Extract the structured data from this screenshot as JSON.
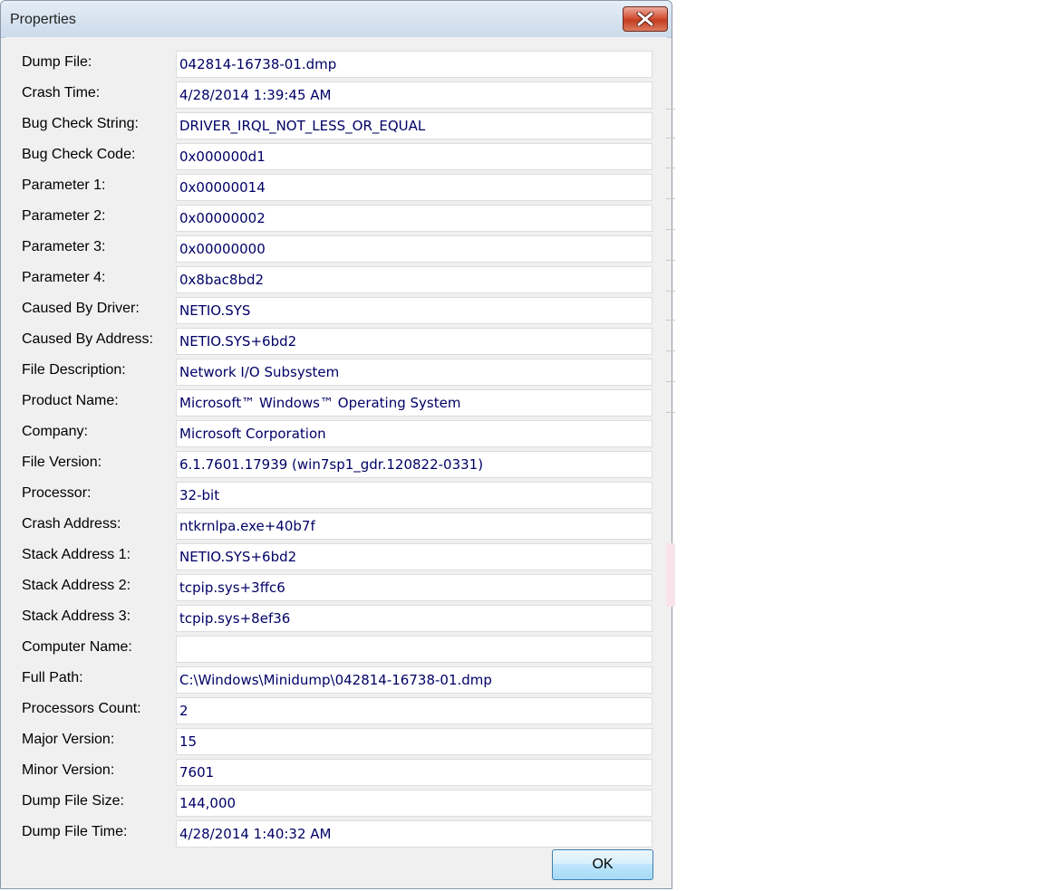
{
  "window": {
    "title": "Properties"
  },
  "properties": [
    {
      "label": "Dump File:",
      "value": "042814-16738-01.dmp"
    },
    {
      "label": "Crash Time:",
      "value": "4/28/2014 1:39:45 AM"
    },
    {
      "label": "Bug Check String:",
      "value": "DRIVER_IRQL_NOT_LESS_OR_EQUAL"
    },
    {
      "label": "Bug Check Code:",
      "value": "0x000000d1"
    },
    {
      "label": "Parameter 1:",
      "value": "0x00000014"
    },
    {
      "label": "Parameter 2:",
      "value": "0x00000002"
    },
    {
      "label": "Parameter 3:",
      "value": "0x00000000"
    },
    {
      "label": "Parameter 4:",
      "value": "0x8bac8bd2"
    },
    {
      "label": "Caused By Driver:",
      "value": "NETIO.SYS"
    },
    {
      "label": "Caused By Address:",
      "value": "NETIO.SYS+6bd2"
    },
    {
      "label": "File Description:",
      "value": "Network I/O Subsystem"
    },
    {
      "label": "Product Name:",
      "value": "Microsoft™ Windows™ Operating System"
    },
    {
      "label": "Company:",
      "value": "Microsoft Corporation"
    },
    {
      "label": "File Version:",
      "value": "6.1.7601.17939 (win7sp1_gdr.120822-0331)"
    },
    {
      "label": "Processor:",
      "value": "32-bit"
    },
    {
      "label": "Crash Address:",
      "value": "ntkrnlpa.exe+40b7f"
    },
    {
      "label": "Stack Address 1:",
      "value": "NETIO.SYS+6bd2"
    },
    {
      "label": "Stack Address 2:",
      "value": "tcpip.sys+3ffc6"
    },
    {
      "label": "Stack Address 3:",
      "value": "tcpip.sys+8ef36"
    },
    {
      "label": "Computer Name:",
      "value": ""
    },
    {
      "label": "Full Path:",
      "value": "C:\\Windows\\Minidump\\042814-16738-01.dmp"
    },
    {
      "label": "Processors Count:",
      "value": "2"
    },
    {
      "label": "Major Version:",
      "value": "15"
    },
    {
      "label": "Minor Version:",
      "value": "7601"
    },
    {
      "label": "Dump File Size:",
      "value": "144,000"
    },
    {
      "label": "Dump File Time:",
      "value": "4/28/2014 1:40:32 AM"
    }
  ],
  "buttons": {
    "ok": "OK"
  },
  "icons": {
    "close": "close-icon"
  },
  "colors": {
    "value_text": "#000066",
    "close_button": "#c43d21",
    "ok_border": "#3c7fb1"
  }
}
